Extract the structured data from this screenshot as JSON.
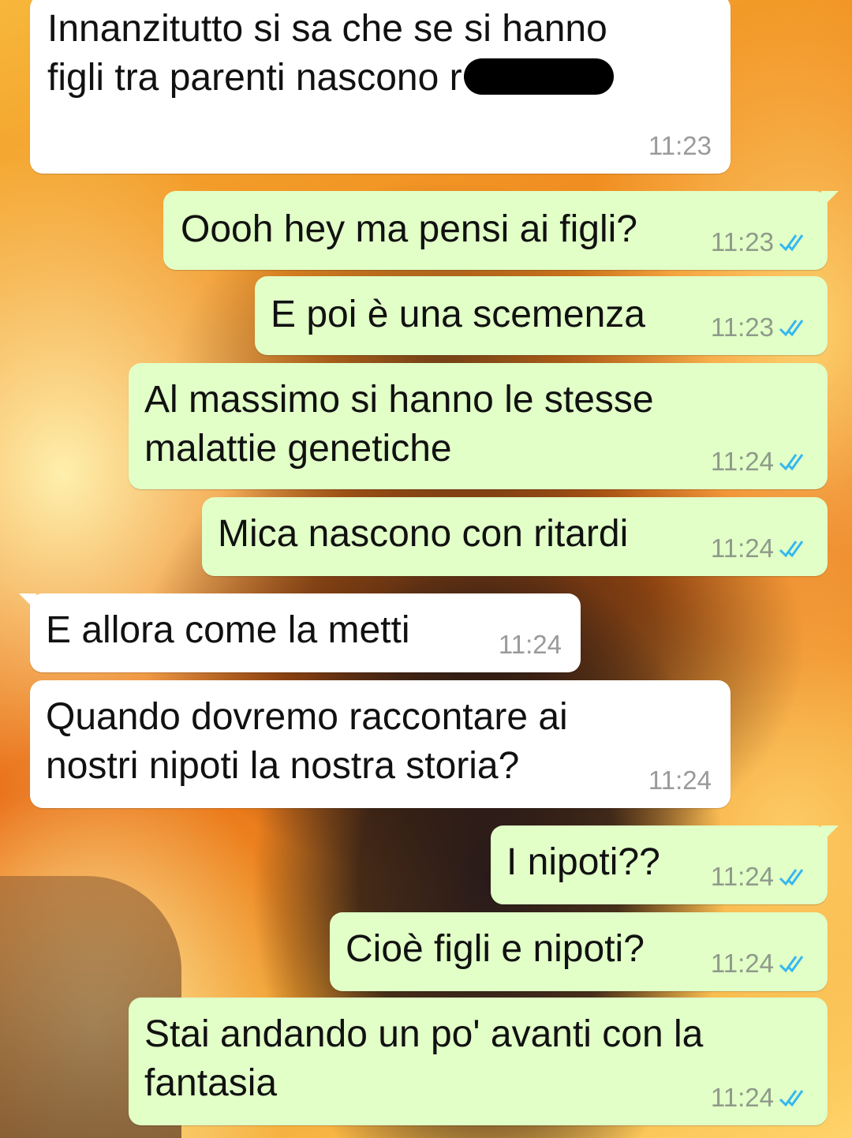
{
  "chat": {
    "messages": [
      {
        "direction": "in",
        "lines": [
          "Innanzitutto si sa che se si hanno",
          "figli tra parenti nascono r"
        ],
        "redacted": true,
        "time": "11:23"
      },
      {
        "direction": "out",
        "lines": [
          "Oooh hey ma pensi ai figli?"
        ],
        "time": "11:23",
        "status": "read"
      },
      {
        "direction": "out",
        "lines": [
          "E poi è una scemenza"
        ],
        "time": "11:23",
        "status": "read"
      },
      {
        "direction": "out",
        "lines": [
          "Al massimo si hanno le stesse",
          "malattie genetiche"
        ],
        "time": "11:24",
        "status": "read"
      },
      {
        "direction": "out",
        "lines": [
          "Mica nascono con ritardi"
        ],
        "time": "11:24",
        "status": "read"
      },
      {
        "direction": "in",
        "lines": [
          "E allora come la metti"
        ],
        "time": "11:24"
      },
      {
        "direction": "in",
        "lines": [
          "Quando dovremo raccontare ai",
          "nostri nipoti la nostra storia?"
        ],
        "time": "11:24"
      },
      {
        "direction": "out",
        "lines": [
          "I nipoti??"
        ],
        "time": "11:24",
        "status": "read"
      },
      {
        "direction": "out",
        "lines": [
          "Cioè figli e nipoti?"
        ],
        "time": "11:24",
        "status": "read"
      },
      {
        "direction": "out",
        "lines": [
          "Stai andando un po' avanti con la",
          "fantasia"
        ],
        "time": "11:24",
        "status": "read"
      }
    ]
  },
  "colors": {
    "incoming_bubble": "#ffffff",
    "outgoing_bubble": "#e1ffc7",
    "read_tick": "#34b7f1",
    "wallpaper": "fire explosion"
  },
  "icons": {
    "read_receipt": "double-check-icon",
    "redaction": "redaction-mark"
  }
}
